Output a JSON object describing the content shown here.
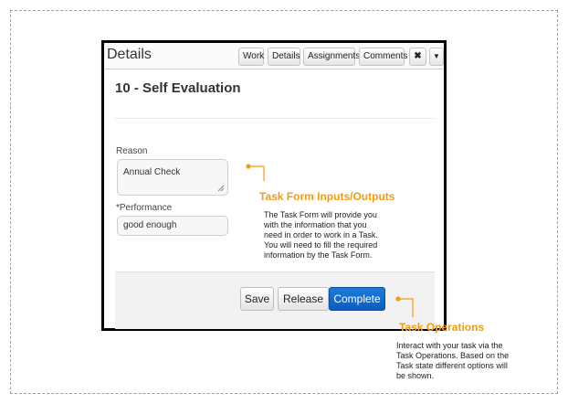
{
  "panel": {
    "title": "Details",
    "buttons": {
      "work": "Work",
      "details": "Details",
      "assignments": "Assignments",
      "comments": "Comments",
      "close": "✖",
      "dropdown": "▼"
    }
  },
  "task": {
    "title": "10 - Self Evaluation"
  },
  "form": {
    "reason_label": "Reason",
    "reason_value": "Annual Check",
    "performance_label": "*Performance",
    "performance_value": "good enough"
  },
  "actions": {
    "save": "Save",
    "release": "Release",
    "complete": "Complete"
  },
  "annotations": {
    "form": {
      "title": "Task Form Inputs/Outputs",
      "lines": [
        "The Task Form will provide you",
        "with the information that you",
        "need in order to work in a Task.",
        "You will need to fill the required",
        "information by the Task Form."
      ]
    },
    "operations": {
      "title": "Task Operations",
      "lines": [
        "Interact with your task via the",
        "Task Operations. Based on the",
        "Task state different options will",
        "be shown."
      ]
    }
  },
  "colors": {
    "annotation": "#f39c12",
    "primary": "#0b5dc0"
  }
}
